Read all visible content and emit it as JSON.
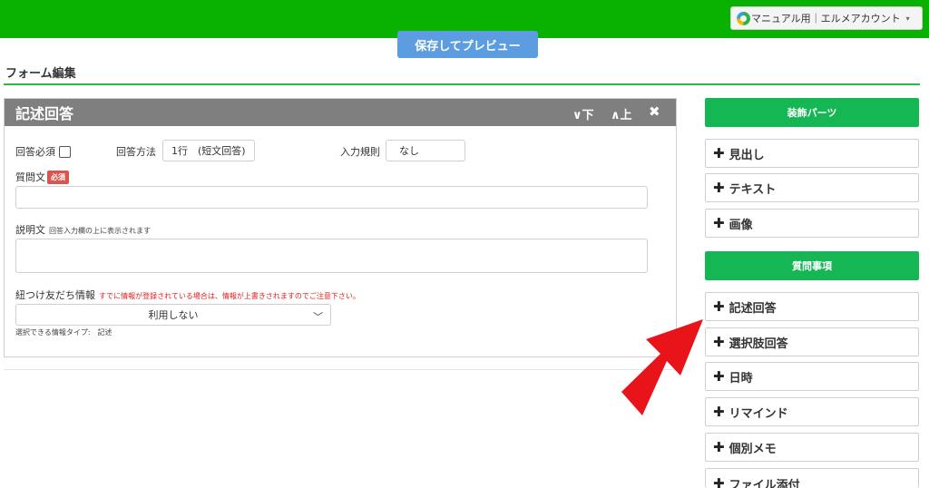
{
  "header": {
    "account_label": "マニュアル用｜エルメアカウント",
    "save_preview_label": "保存してプレビュー"
  },
  "page": {
    "title": "フォーム編集"
  },
  "panel": {
    "title": "記述回答",
    "controls": {
      "down": "∨下",
      "up": "∧上",
      "close": "✖"
    },
    "required_label": "回答必須",
    "answer_method_label": "回答方法",
    "answer_method_value": "1行　(短文回答)",
    "input_rule_label": "入力規則",
    "input_rule_value": "なし",
    "question_label": "質問文",
    "required_badge": "必須",
    "description_label": "説明文",
    "description_hint": "回答入力欄の上に表示されます",
    "friend_info_label": "紐つけ友だち情報",
    "friend_info_warning": "すでに情報が登録されている場合は、情報が上書きされますのでご注意下さい。",
    "friend_info_value": "利用しない",
    "selectable_type_note": "選択できる情報タイプ:　記述"
  },
  "sidebar": {
    "decoration_header": "装飾パーツ",
    "decoration_items": [
      "見出し",
      "テキスト",
      "画像"
    ],
    "question_header": "質問事項",
    "question_items": [
      "記述回答",
      "選択肢回答",
      "日時",
      "リマインド",
      "個別メモ",
      "ファイル添付"
    ]
  },
  "colors": {
    "topbar": "#09b100",
    "accent_green": "#15b755",
    "save_button": "#5b9de0",
    "panel_header": "#7f7f7f",
    "annotation_arrow": "#e8141a"
  }
}
